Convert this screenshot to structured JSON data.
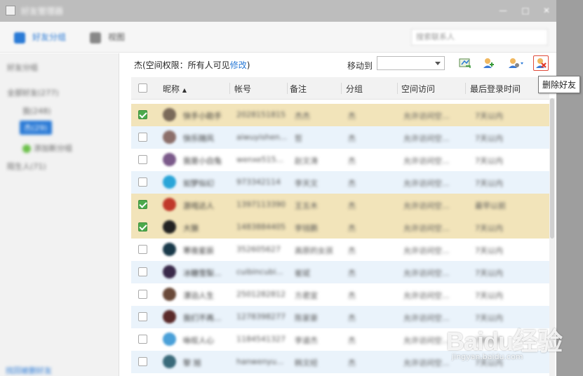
{
  "window": {
    "title": "好友管理器",
    "min_glyph": "—",
    "max_glyph": "□",
    "close_glyph": "✕"
  },
  "toolbar": {
    "tab_friends_label": "好友分组",
    "tab_view_label": "视图",
    "search_placeholder": "搜索联系人"
  },
  "sidebar": {
    "header": "好友分组",
    "all_friends": "全部好友(277)",
    "group_1": "我(248)",
    "group_2_selected": "杰(29)",
    "add_group": "添加新分组",
    "strangers": "陌生人(71)",
    "footer_link": "找回被删好友"
  },
  "main": {
    "group_info_prefix": "杰(空间权限：所有人可见",
    "group_info_edit": "修改",
    "group_info_suffix": ")",
    "move_to_label": "移动到",
    "tooltip_delete": "删除好友",
    "icons": [
      "export-icon",
      "add-friend-icon",
      "manage-friend-icon",
      "delete-friend-icon"
    ]
  },
  "table": {
    "headers": {
      "nickname": "昵称",
      "sort_arrow": "▲",
      "account": "帐号",
      "note": "备注",
      "group": "分组",
      "space": "空间访问",
      "last_login": "最后登录时间"
    },
    "rows": [
      {
        "checked": true,
        "avatar": "#7a6a5a",
        "nick": "快手小助手",
        "acct": "2028151815",
        "note": "杰杰",
        "group": "杰",
        "space": "允许访问空...",
        "login": "7天以内"
      },
      {
        "checked": false,
        "avatar": "#8c6f6a",
        "nick": "快乐随风",
        "acct": "aiwuyishen...",
        "note": "哲",
        "group": "杰",
        "space": "允许访问空...",
        "login": "7天以内"
      },
      {
        "checked": false,
        "avatar": "#7b5a8a",
        "nick": "我是小白兔",
        "acct": "wenxe515...",
        "note": "赵文涛",
        "group": "杰",
        "space": "允许访问空...",
        "login": "7天以内"
      },
      {
        "checked": false,
        "avatar": "#2aa5d8",
        "nick": "如梦似幻",
        "acct": "973342114",
        "note": "李天文",
        "group": "杰",
        "space": "允许访问空...",
        "login": "7天以内"
      },
      {
        "checked": true,
        "avatar": "#c0392b",
        "nick": "游戏达人",
        "acct": "1397113390",
        "note": "王五木",
        "group": "杰",
        "space": "允许访问空...",
        "login": "最早以前"
      },
      {
        "checked": true,
        "avatar": "#222222",
        "nick": "大狼",
        "acct": "1483884405",
        "note": "李钱鹏",
        "group": "杰",
        "space": "允许访问空...",
        "login": "7天以内"
      },
      {
        "checked": false,
        "avatar": "#1a3a4a",
        "nick": "寒夜星辰",
        "acct": "352605627",
        "note": "高原的女孩",
        "group": "杰",
        "space": "允许访问空...",
        "login": "7天以内"
      },
      {
        "checked": false,
        "avatar": "#3a2a4a",
        "nick": "冰糖雪梨...",
        "acct": "cuibincubi...",
        "note": "崔斌",
        "group": "杰",
        "space": "允许访问空...",
        "login": "7天以内"
      },
      {
        "checked": false,
        "avatar": "#6a4a3a",
        "nick": "漂泊人生",
        "acct": "2501282812",
        "note": "方君宜",
        "group": "杰",
        "space": "允许访问空...",
        "login": "7天以内"
      },
      {
        "checked": false,
        "avatar": "#5a2a2a",
        "nick": "我们不再...",
        "acct": "1278398277",
        "note": "陈家豪",
        "group": "杰",
        "space": "允许访问空...",
        "login": "7天以内"
      },
      {
        "checked": false,
        "avatar": "#4aa0d8",
        "nick": "咏叹人心",
        "acct": "1184541327",
        "note": "李道杰",
        "group": "杰",
        "space": "允许访问空...",
        "login": "7天以内"
      },
      {
        "checked": false,
        "avatar": "#3a6a7a",
        "nick": "黎 旭",
        "acct": "hanwenyu...",
        "note": "韩文经",
        "group": "杰",
        "space": "允许访问空...",
        "login": "7天以内"
      }
    ]
  },
  "watermark": {
    "main": "Baidu经验",
    "sub": "jingyan.baidu.com"
  }
}
